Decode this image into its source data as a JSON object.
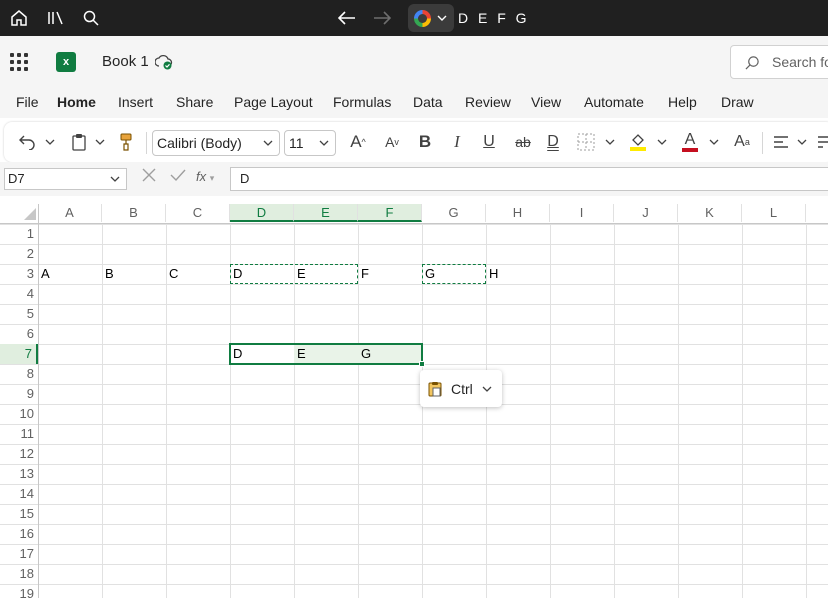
{
  "browser": {
    "url_text": "D E F G",
    "icons": [
      "home-icon",
      "library-icon",
      "search-icon",
      "back-arrow-icon",
      "forward-arrow-icon",
      "google-icon",
      "chevron-down-icon"
    ]
  },
  "app": {
    "book_name": "Book 1",
    "search_placeholder": "Search fo",
    "brand_color": "#107c41"
  },
  "menu": {
    "items": [
      "File",
      "Home",
      "Insert",
      "Share",
      "Page Layout",
      "Formulas",
      "Data",
      "Review",
      "View",
      "Automate",
      "Help",
      "Draw"
    ],
    "active": "Home"
  },
  "ribbon": {
    "font_name": "Calibri (Body)",
    "font_size": "11",
    "grow_font": "A",
    "shrink_font": "A",
    "bold": "B",
    "italic": "I",
    "underline": "U",
    "strike": "ab",
    "double_underline": "D",
    "font_color": "A",
    "font_color_hex": "#c50f1f",
    "fill_color_hex": "#ffeb00",
    "styles": "A"
  },
  "formula_bar": {
    "name_box": "D7",
    "fx": "fx",
    "value": "D"
  },
  "sheet": {
    "columns": [
      "A",
      "B",
      "C",
      "D",
      "E",
      "F",
      "G",
      "H",
      "I",
      "J",
      "K",
      "L"
    ],
    "rows": [
      "1",
      "2",
      "3",
      "4",
      "5",
      "6",
      "7",
      "8",
      "9",
      "10",
      "11",
      "12",
      "13",
      "14",
      "15",
      "16",
      "17",
      "18",
      "19"
    ],
    "selected_columns": [
      "D",
      "E",
      "F"
    ],
    "selected_row": "7",
    "cells": {
      "A3": "A",
      "B3": "B",
      "C3": "C",
      "D3": "D",
      "E3": "E",
      "F3": "F",
      "G3": "G",
      "H3": "H",
      "D7": "D",
      "E7": "E",
      "F7": "G"
    },
    "selection_color": "#107c41",
    "copy_marquee": [
      "D3:E3",
      "G3"
    ]
  },
  "paste_options": {
    "label": "Ctrl"
  }
}
